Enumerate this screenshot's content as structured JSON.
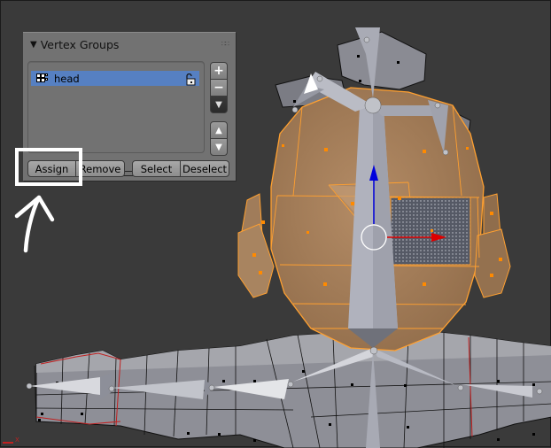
{
  "panel": {
    "title": "Vertex Groups",
    "collapse_icon": "triangle-down-icon",
    "drag_icon": "drag-dots-icon",
    "groups": [
      {
        "name": "head",
        "selected": true,
        "locked": false,
        "icon": "vertex-group-icon",
        "lock_icon": "unlock-icon"
      }
    ],
    "side_buttons": [
      {
        "id": "add",
        "glyph": "+",
        "icon": "plus-icon"
      },
      {
        "id": "remove",
        "glyph": "−",
        "icon": "minus-icon"
      },
      {
        "id": "specials",
        "glyph": "▼",
        "icon": "specials-menu-icon"
      },
      {
        "id": "move_up",
        "glyph": "▲",
        "icon": "move-up-icon"
      },
      {
        "id": "move_down",
        "glyph": "▼",
        "icon": "move-down-icon"
      }
    ],
    "buttons": {
      "assign": "Assign",
      "remove": "Remove",
      "select": "Select",
      "deselect": "Deselect"
    }
  },
  "viewport": {
    "axis_label": "X",
    "colors": {
      "background": "#3a3a3a",
      "selected_mesh": "#a8835f",
      "mesh_edge_selected": "#ffa030",
      "bone": "#b0b2be",
      "mesh": "#8f9097",
      "manipulator_z": "#0000dd",
      "manipulator_x": "#dd0000",
      "highlight": "#5680c2"
    }
  },
  "annotation": {
    "target": "Assign",
    "color": "#ffffff"
  }
}
